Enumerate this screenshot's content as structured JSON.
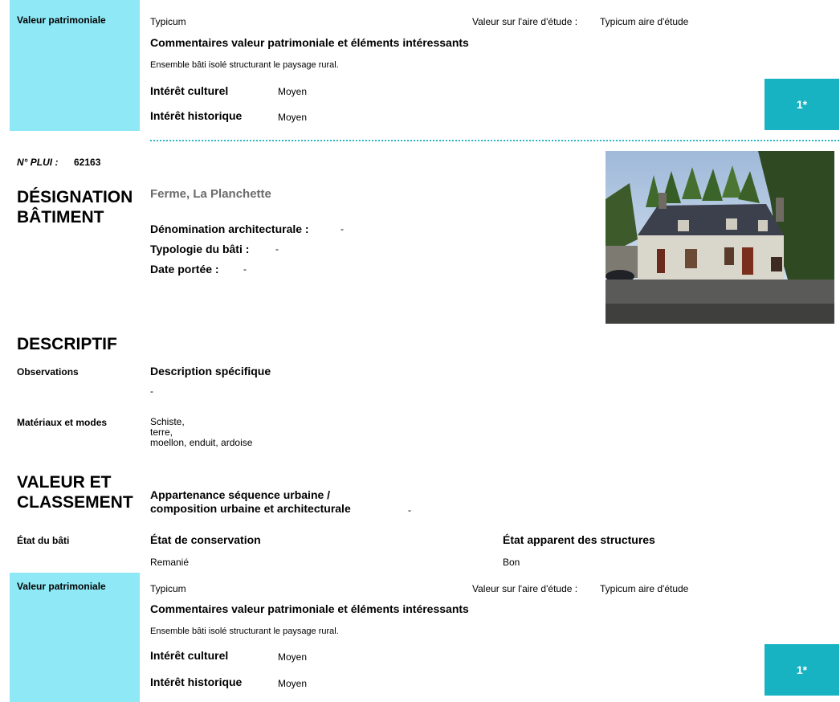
{
  "top_block": {
    "side_label": "Valeur patrimoniale",
    "typicum": "Typicum",
    "aire_label": "Valeur sur l'aire d'étude :",
    "aire_value": "Typicum aire d'étude",
    "comment_title": "Commentaires valeur patrimoniale et éléments intéressants",
    "comment_text": "Ensemble bâti isolé structurant le paysage rural.",
    "culturel_label": "Intérêt culturel",
    "culturel_value": "Moyen",
    "historique_label": "Intérêt historique",
    "historique_value": "Moyen",
    "badge": "1*"
  },
  "plui": {
    "label": "N° PLUI :",
    "value": "62163"
  },
  "designation": {
    "heading_line1": "DÉSIGNATION",
    "heading_line2": "BÂTIMENT",
    "name": "Ferme, La Planchette",
    "denomination_label": "Dénomination architecturale :",
    "denomination_value": "-",
    "typologie_label": "Typologie du bâti :",
    "typologie_value": "-",
    "date_label": "Date portée :",
    "date_value": "-"
  },
  "descriptif": {
    "heading": "DESCRIPTIF",
    "observations_label": "Observations",
    "description_title": "Description spécifique",
    "description_value": "-",
    "materiaux_label": "Matériaux et modes",
    "materiaux_line1": "Schiste,",
    "materiaux_line2": "terre,",
    "materiaux_line3": "moellon, enduit, ardoise"
  },
  "valeur": {
    "heading_line1": "VALEUR ET",
    "heading_line2": "CLASSEMENT",
    "appartenance_line1": "Appartenance séquence urbaine /",
    "appartenance_line2": "composition urbaine et architecturale",
    "appartenance_value": "-",
    "etat_side_label": "État du bâti",
    "conservation_title": "État de conservation",
    "conservation_value": "Remanié",
    "structures_title": "État apparent des structures",
    "structures_value": "Bon"
  },
  "bottom_block": {
    "side_label": "Valeur patrimoniale",
    "typicum": "Typicum",
    "aire_label": "Valeur sur l'aire d'étude :",
    "aire_value": "Typicum aire d'étude",
    "comment_title": "Commentaires valeur patrimoniale et éléments intéressants",
    "comment_text": "Ensemble bâti isolé structurant le paysage rural.",
    "culturel_label": "Intérêt culturel",
    "culturel_value": "Moyen",
    "historique_label": "Intérêt historique",
    "historique_value": "Moyen",
    "badge": "1*"
  },
  "colors": {
    "side_panel": "#8ee8f5",
    "badge": "#17b3c2",
    "divider": "#2bb7c8"
  }
}
